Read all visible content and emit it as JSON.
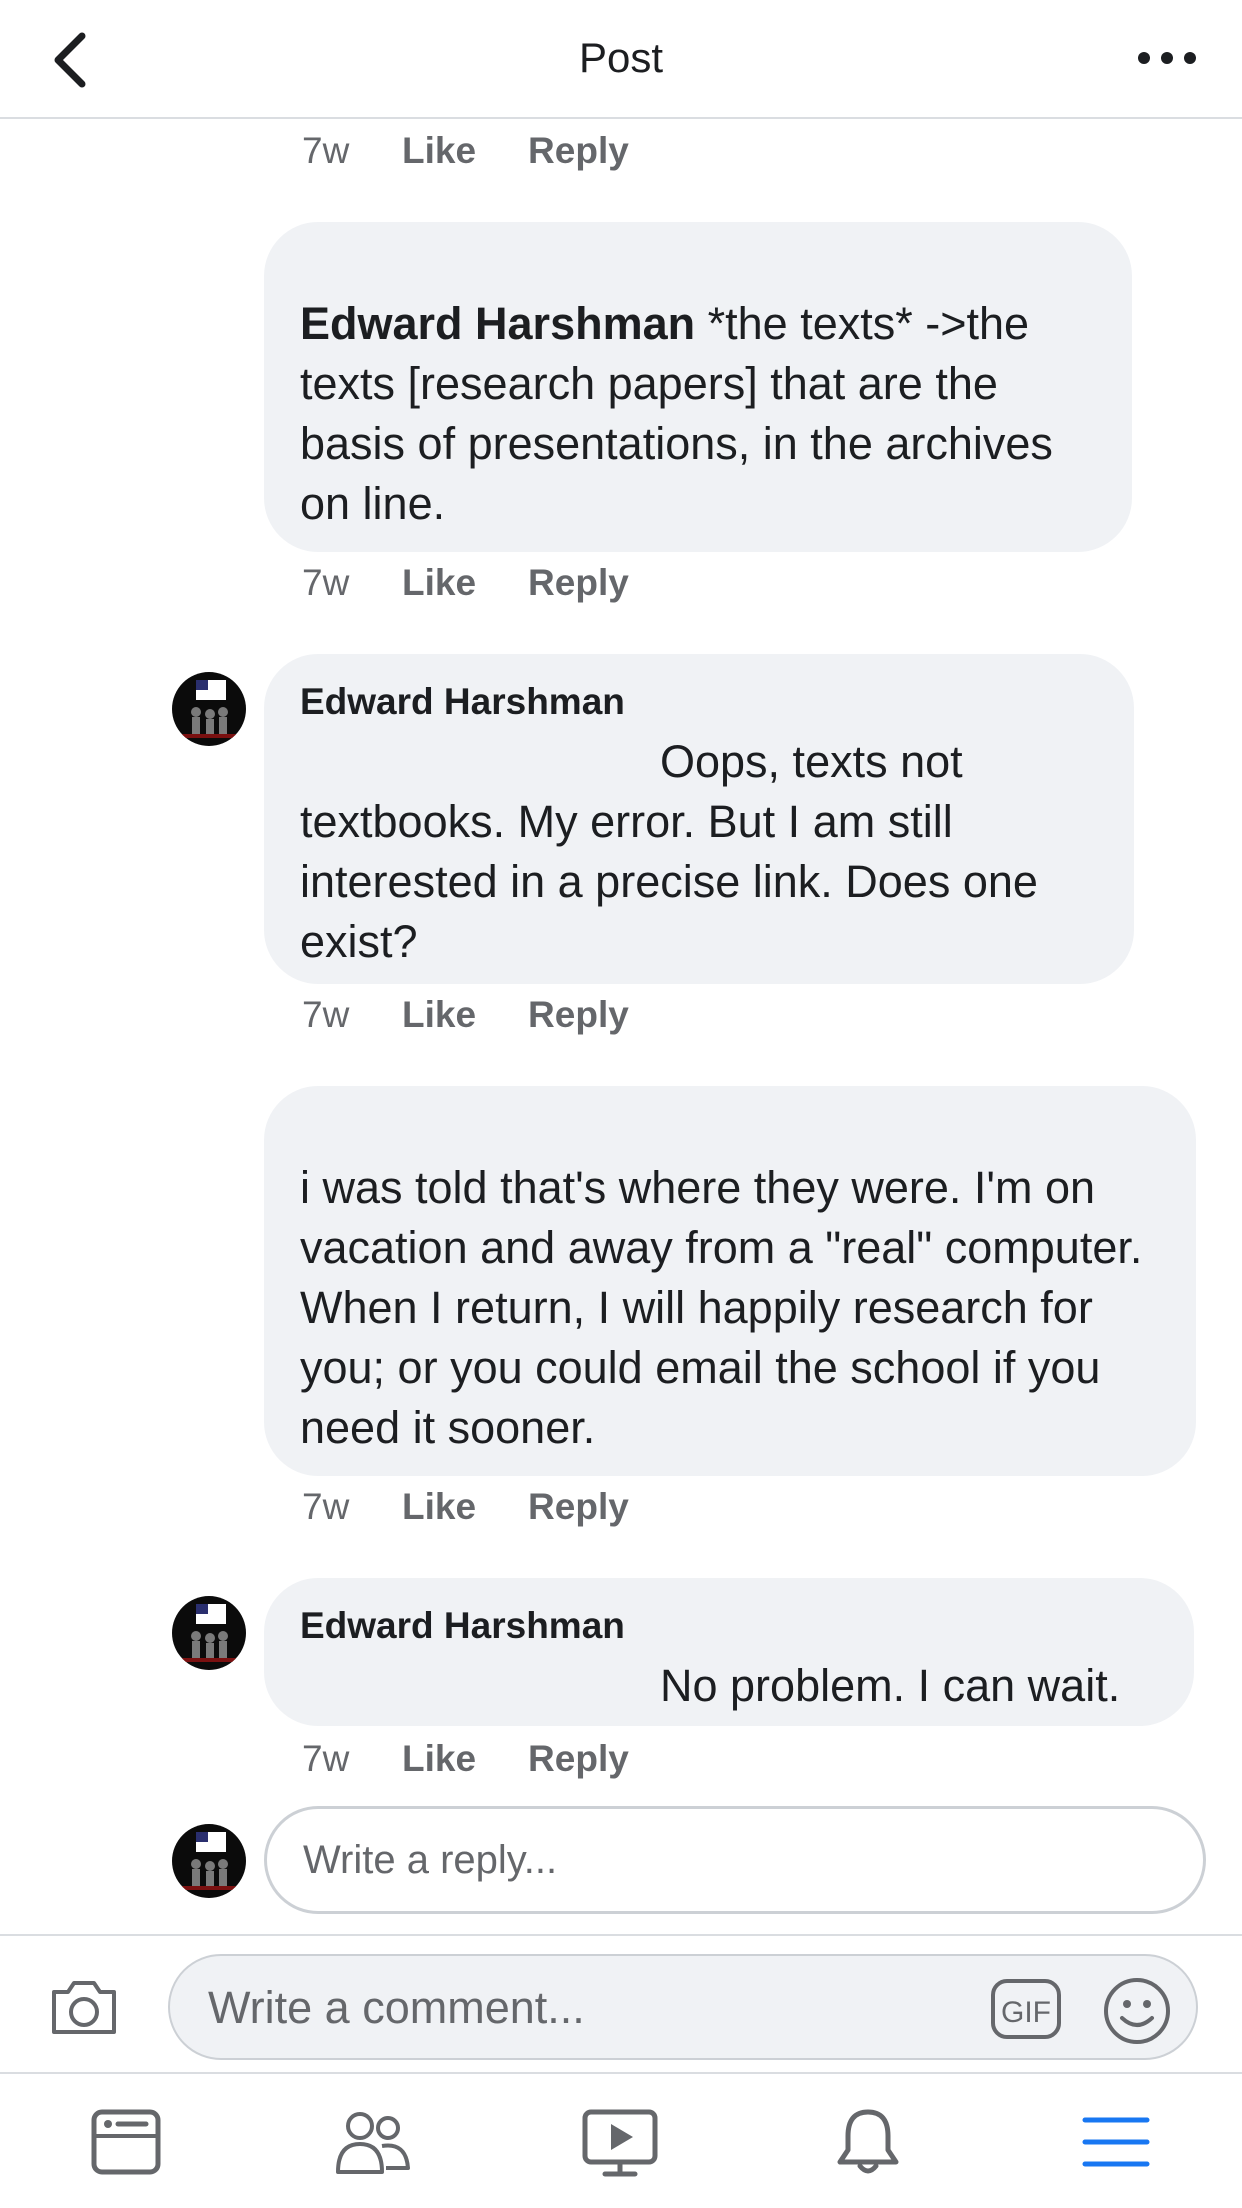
{
  "header": {
    "title": "Post"
  },
  "comments": [
    {
      "text": null,
      "meta": {
        "time": "7w",
        "like": "Like",
        "reply": "Reply"
      }
    },
    {
      "author": "Edward Harshman",
      "body": " *the texts* ->the texts [research papers] that are the basis of presentations, in the archives on line.",
      "meta": {
        "time": "7w",
        "like": "Like",
        "reply": "Reply"
      }
    },
    {
      "author": "Edward Harshman",
      "line1": "Oops, texts not",
      "body": "textbooks. My error. But I am still interested in a precise link. Does one exist?",
      "meta": {
        "time": "7w",
        "like": "Like",
        "reply": "Reply"
      }
    },
    {
      "body": "i was told that's where they were.  I'm on vacation and away from a \"real\" computer.  When I return, I will happily research for you; or you could email the school if you need it sooner.",
      "meta": {
        "time": "7w",
        "like": "Like",
        "reply": "Reply"
      }
    },
    {
      "author": "Edward Harshman",
      "body": "No problem. I can wait.",
      "meta": {
        "time": "7w",
        "like": "Like",
        "reply": "Reply"
      }
    }
  ],
  "reply_input": {
    "placeholder": "Write a reply..."
  },
  "comment_bar": {
    "placeholder": "Write a comment...",
    "gif_label": "GIF"
  },
  "nav": {
    "items": [
      "news-feed-icon",
      "friends-icon",
      "watch-icon",
      "notifications-icon",
      "menu-icon"
    ],
    "active_color": "#1877f2"
  },
  "colors": {
    "bubble": "#f0f2f5",
    "meta": "#65676b",
    "text": "#1c1e21"
  }
}
